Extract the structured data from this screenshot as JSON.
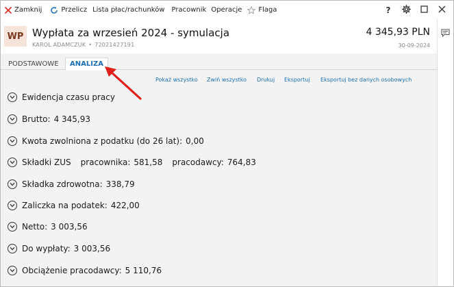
{
  "toolbar": {
    "close_label": "Zamknij",
    "recalc_label": "Przelicz",
    "payrolls_label": "Lista płac/rachunków",
    "employee_label": "Pracownik",
    "operations_label": "Operacje",
    "flag_label": "Flaga",
    "help_label": "?"
  },
  "header": {
    "avatar_initials": "WP",
    "title": "Wypłata za wrzesień 2024 - symulacja",
    "employee_name": "KAROL ADAMCZUK",
    "separator": "•",
    "employee_id": "72021427191",
    "amount": "4 345,93 PLN",
    "date": "30-09-2024"
  },
  "tabs": [
    {
      "label": "PODSTAWOWE",
      "active": false
    },
    {
      "label": "ANALIZA",
      "active": true
    }
  ],
  "links": {
    "show_all": "Pokaż wszystko",
    "collapse_all": "Zwiń wszystko",
    "print": "Drukuj",
    "export": "Eksportuj",
    "export_anon": "Eksportuj bez danych osobowych"
  },
  "sections": {
    "time": {
      "label": "Ewidencja czasu pracy"
    },
    "gross": {
      "label": "Brutto:",
      "value": "4 345,93"
    },
    "tax_free": {
      "label": "Kwota zwolniona z podatku (do 26 lat):",
      "value": "0,00"
    },
    "zus": {
      "label": "Składki ZUS",
      "employee_label": "pracownika:",
      "employee_value": "581,58",
      "employer_label": "pracodawcy:",
      "employer_value": "764,83"
    },
    "health": {
      "label": "Składka zdrowotna:",
      "value": "338,79"
    },
    "advance": {
      "label": "Zaliczka na podatek:",
      "value": "422,00"
    },
    "net": {
      "label": "Netto:",
      "value": "3 003,56"
    },
    "payout": {
      "label": "Do wypłaty:",
      "value": "3 003,56"
    },
    "employer_cost": {
      "label": "Obciążenie pracodawcy:",
      "value": "5 110,76"
    }
  },
  "colors": {
    "accent": "#1a6fb5",
    "close_icon": "#d9342b",
    "avatar_bg": "#f6e3da",
    "arrow": "#e0201b"
  }
}
